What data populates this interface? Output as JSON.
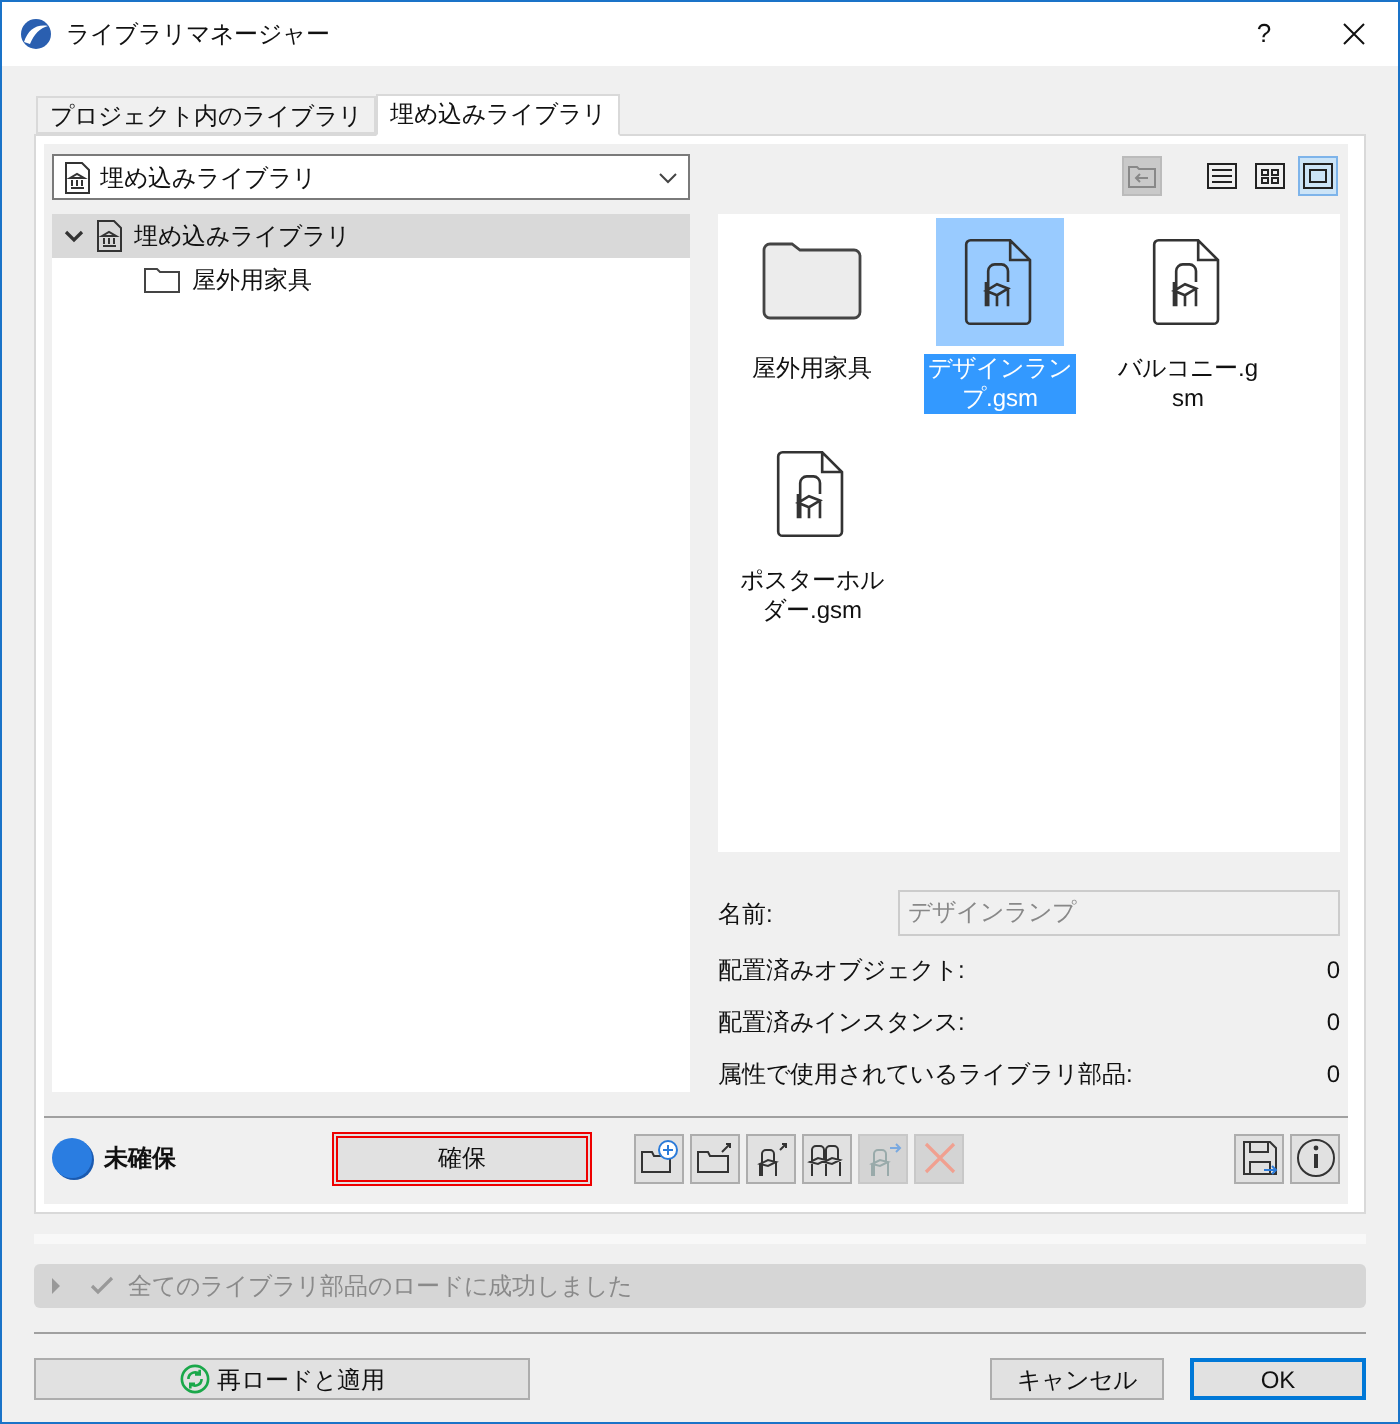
{
  "window": {
    "title": "ライブラリマネージャー",
    "help": "?"
  },
  "tabs": [
    {
      "label": "プロジェクト内のライブラリ",
      "selected": false
    },
    {
      "label": "埋め込みライブラリ",
      "selected": true
    }
  ],
  "library_dropdown": {
    "value": "埋め込みライブラリ"
  },
  "tree": [
    {
      "label": "埋め込みライブラリ",
      "kind": "library",
      "expanded": true,
      "selected": true,
      "children": [
        {
          "label": "屋外用家具",
          "kind": "folder",
          "selected": false
        }
      ]
    }
  ],
  "up_button": {
    "disabled": true
  },
  "view_modes": [
    {
      "kind": "list",
      "selected": false
    },
    {
      "kind": "grid",
      "selected": false
    },
    {
      "kind": "large",
      "selected": true
    }
  ],
  "items": [
    {
      "label": "屋外用家具",
      "kind": "folder",
      "selected": false
    },
    {
      "label": "デザインランプ.gsm",
      "kind": "object",
      "selected": true
    },
    {
      "label": "バルコニー.gsm",
      "kind": "object",
      "selected": false
    },
    {
      "label": "ポスターホルダー.gsm",
      "kind": "object",
      "selected": false
    }
  ],
  "details": {
    "name_label": "名前:",
    "name_value": "デザインランプ",
    "stats": [
      {
        "label": "配置済みオブジェクト:",
        "value": "0"
      },
      {
        "label": "配置済みインスタンス:",
        "value": "0"
      },
      {
        "label": "属性で使用されているライブラリ部品:",
        "value": "0"
      }
    ]
  },
  "status": {
    "label": "未確保"
  },
  "secure_button": {
    "label": "確保",
    "highlighted": true
  },
  "tool_buttons": [
    {
      "kind": "add-folder",
      "disabled": false
    },
    {
      "kind": "export-folder",
      "disabled": false
    },
    {
      "kind": "export-object",
      "disabled": false
    },
    {
      "kind": "objects",
      "disabled": false
    },
    {
      "kind": "move-object",
      "disabled": true
    },
    {
      "kind": "delete",
      "disabled": true
    }
  ],
  "side_buttons": [
    {
      "kind": "save",
      "disabled": false
    },
    {
      "kind": "info",
      "disabled": false
    }
  ],
  "message": {
    "text": "全てのライブラリ部品のロードに成功しました",
    "expanded": false
  },
  "reload_button": {
    "label": "再ロードと適用"
  },
  "cancel_button": {
    "label": "キャンセル"
  },
  "ok_button": {
    "label": "OK",
    "default": true
  }
}
